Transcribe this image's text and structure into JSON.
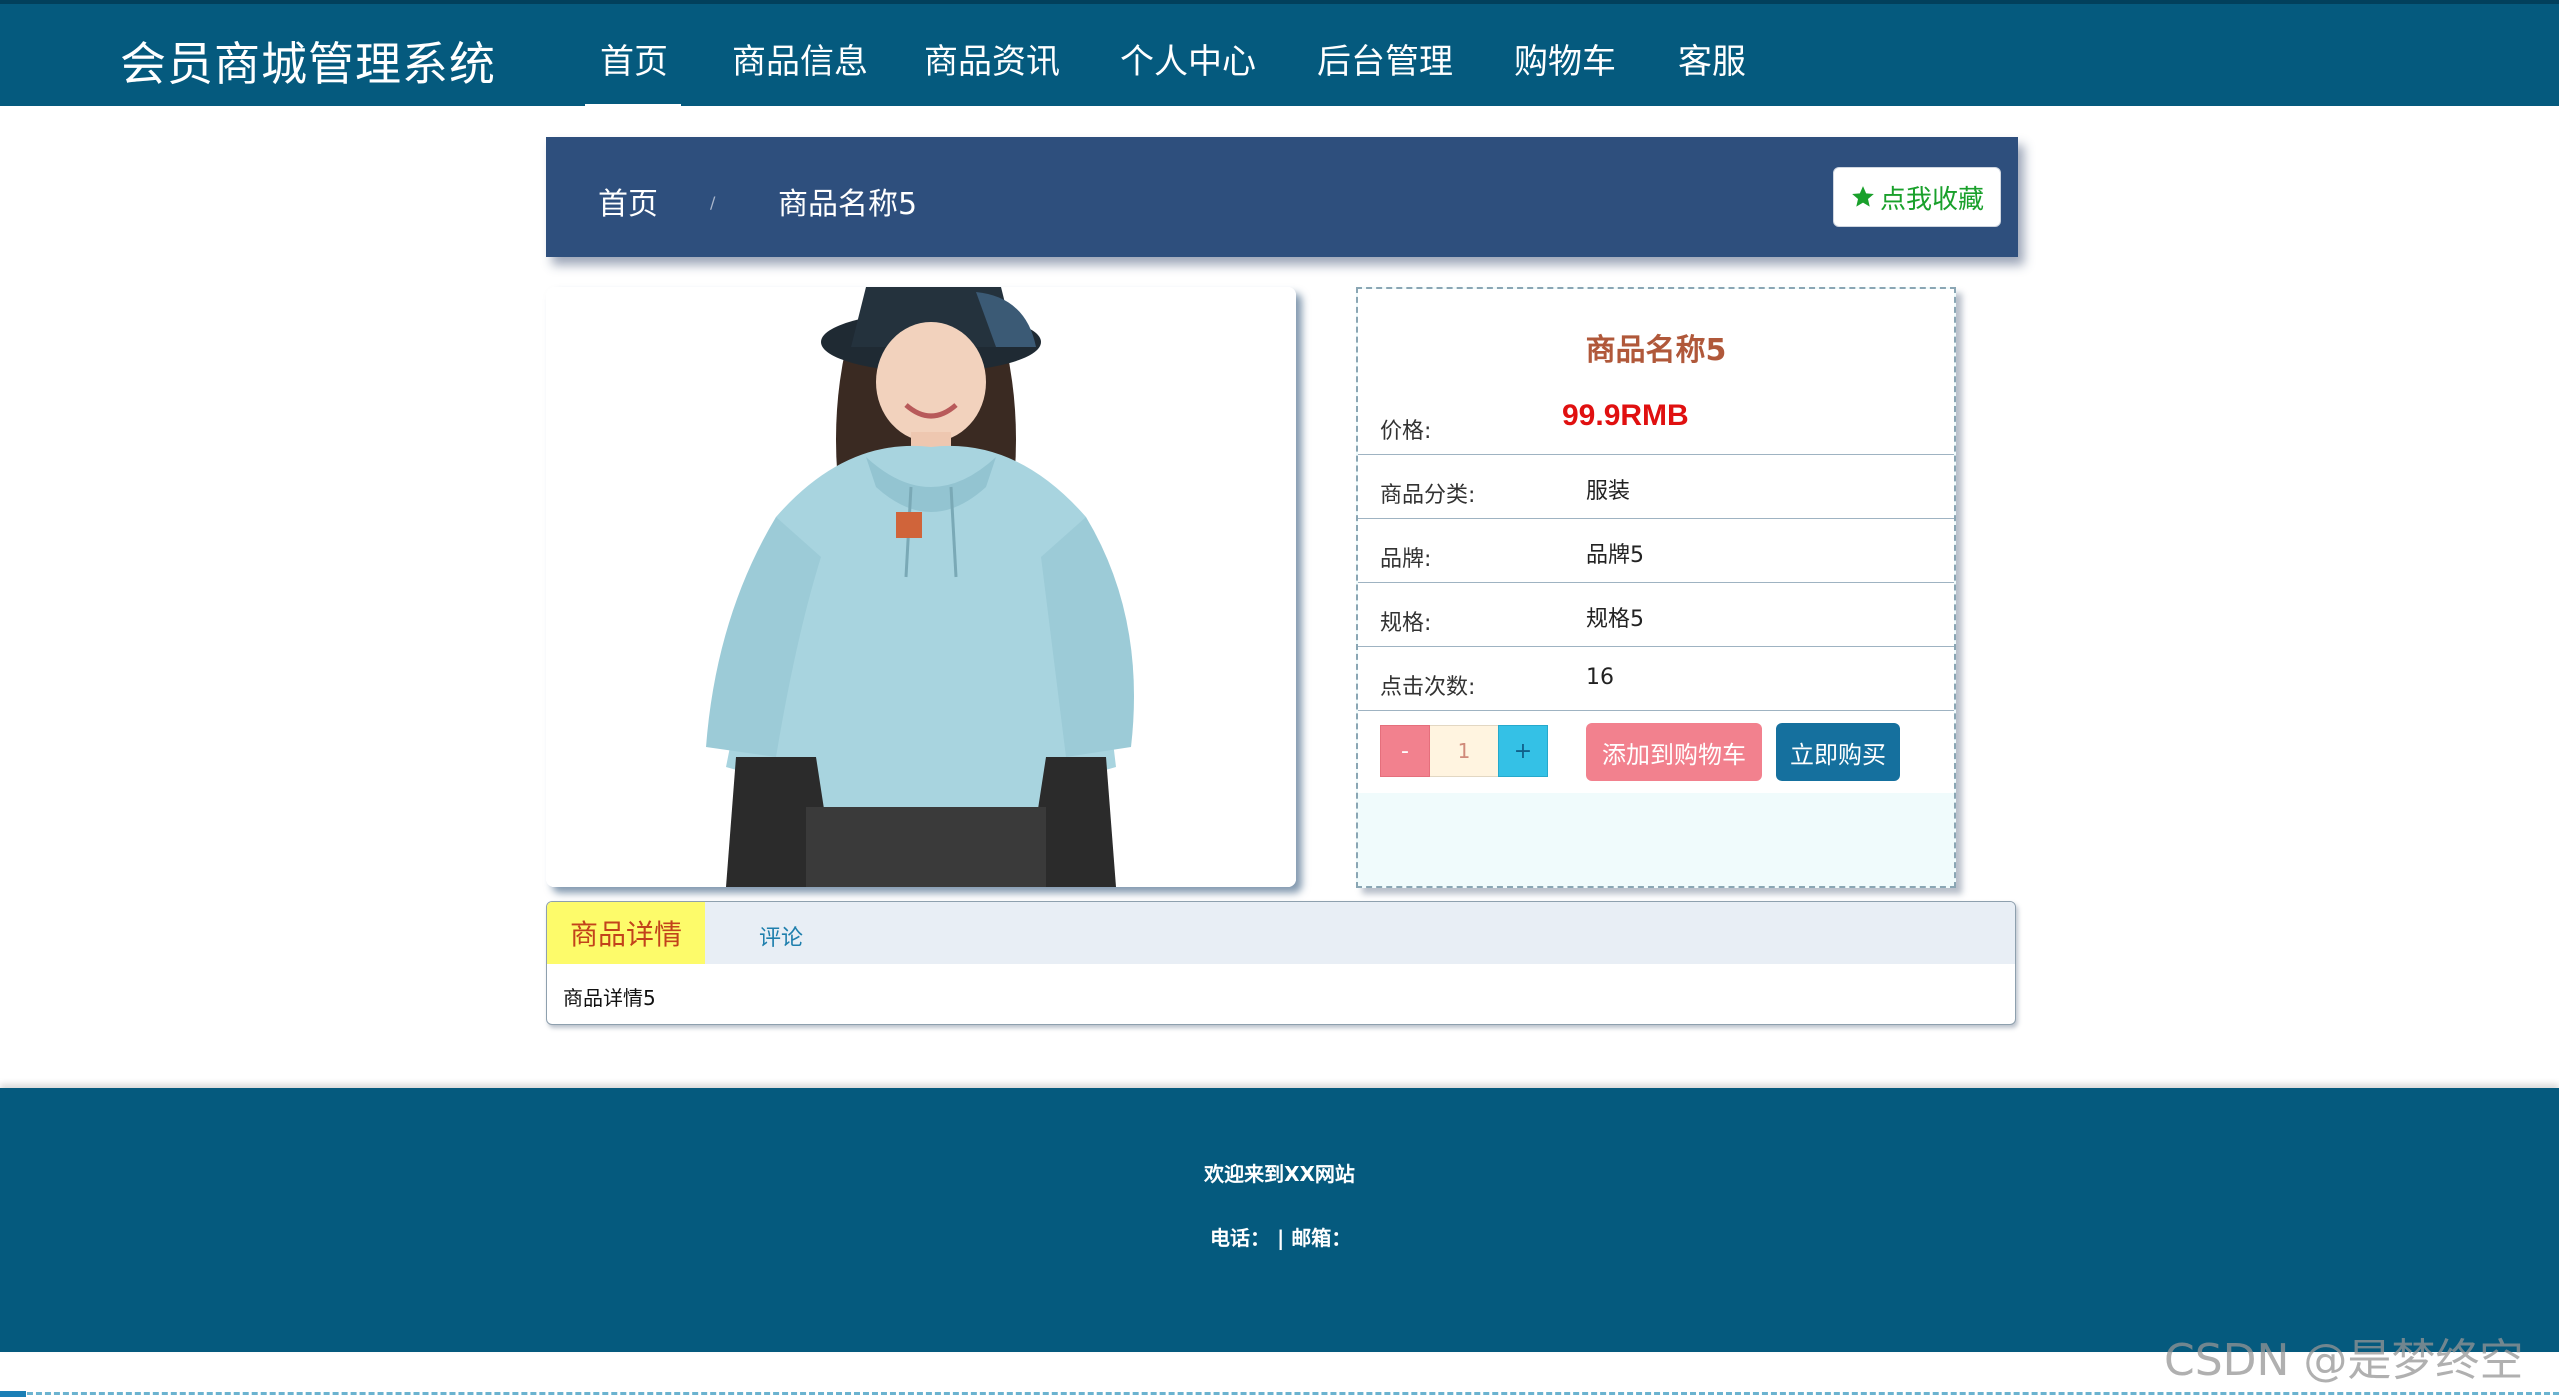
{
  "header": {
    "brand": "会员商城管理系统",
    "nav": [
      {
        "label": "首页",
        "active": true
      },
      {
        "label": "商品信息"
      },
      {
        "label": "商品资讯"
      },
      {
        "label": "个人中心"
      },
      {
        "label": "后台管理"
      },
      {
        "label": "购物车"
      },
      {
        "label": "客服"
      }
    ],
    "accent_color": "#055a7e"
  },
  "breadcrumb": {
    "home": "首页",
    "separator": "/",
    "current": "商品名称5",
    "favorite_button": "点我收藏",
    "favorite_icon": "star-icon"
  },
  "product": {
    "image_alt": "product-photo",
    "name": "商品名称5",
    "price_label": "价格:",
    "price": "99.9RMB",
    "category_label": "商品分类:",
    "category": "服装",
    "brand_label": "品牌:",
    "brand": "品牌5",
    "spec_label": "规格:",
    "spec": "规格5",
    "clicks_label": "点击次数:",
    "clicks": "16",
    "quantity": {
      "minus": "-",
      "value": "1",
      "plus": "+"
    },
    "add_to_cart": "添加到购物车",
    "buy_now": "立即购买"
  },
  "tabs": {
    "items": [
      {
        "label": "商品详情",
        "active": true
      },
      {
        "label": "评论"
      }
    ],
    "content": "商品详情5"
  },
  "footer": {
    "welcome": "欢迎来到XX网站",
    "contact": "电话：  | 邮箱："
  },
  "watermark": "CSDN @是梦终空"
}
